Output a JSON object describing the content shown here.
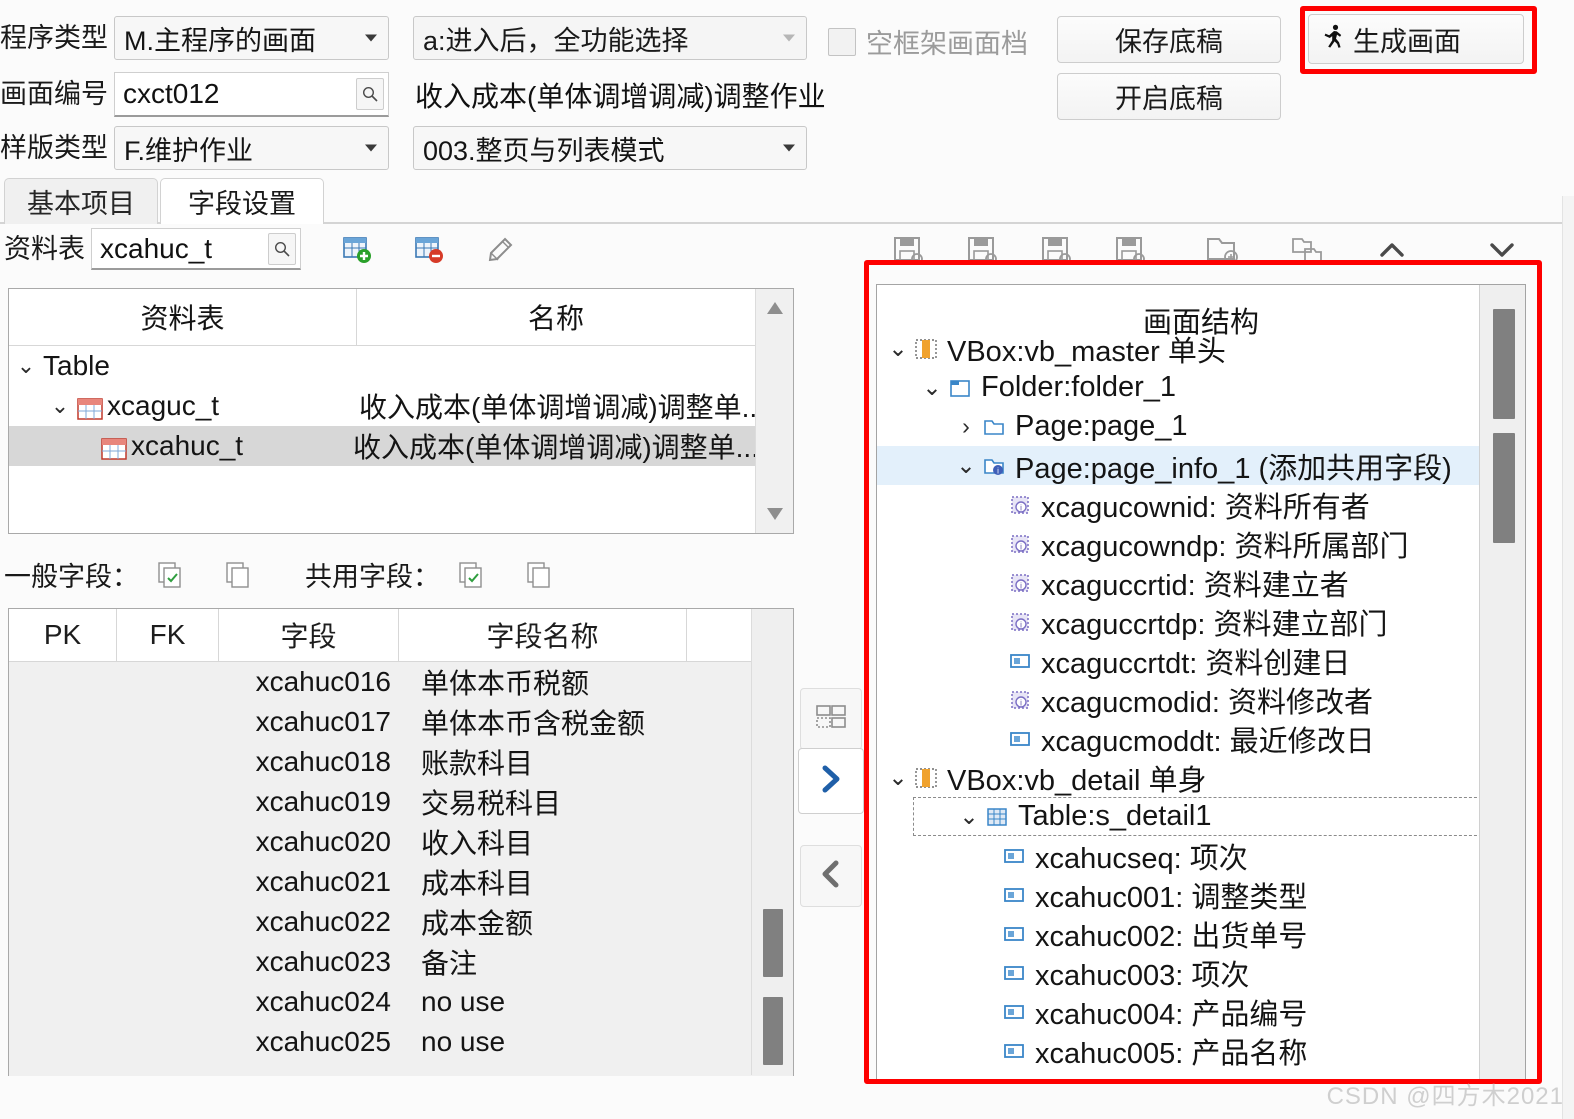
{
  "form": {
    "program_type_label": "程序类型",
    "program_type_value": "M.主程序的画面",
    "entry_mode_value": "a:进入后，全功能选择",
    "screen_no_label": "画面编号",
    "screen_no_value": "cxct012",
    "screen_title": "收入成本(单体调增调减)调整作业",
    "template_type_label": "样版类型",
    "template_type_value": "F.维护作业",
    "layout_mode_value": "003.整页与列表模式",
    "empty_frame_label": "空框架画面档",
    "save_draft_label": "保存底稿",
    "open_draft_label": "开启底稿",
    "generate_label": "生成画面"
  },
  "tabs": [
    {
      "label": "基本项目",
      "active": false
    },
    {
      "label": "字段设置",
      "active": true
    }
  ],
  "source": {
    "label": "资料表",
    "value": "xcahuc_t",
    "icons": [
      "search-icon",
      "add-table-icon",
      "remove-table-icon",
      "link-icon"
    ]
  },
  "table_tree": {
    "headers": [
      "资料表",
      "名称"
    ],
    "rows": [
      {
        "indent": 0,
        "chevron": "v",
        "icon": "none",
        "name": "Table",
        "desc": "",
        "selected": false
      },
      {
        "indent": 1,
        "chevron": "v",
        "icon": "table-icon",
        "name": "xcaguc_t",
        "desc": "收入成本(单体调增调减)调整单...",
        "selected": false
      },
      {
        "indent": 2,
        "chevron": "",
        "icon": "table-icon",
        "name": "xcahuc_t",
        "desc": "收入成本(单体调增调减)调整单...",
        "selected": true
      }
    ]
  },
  "field_captions": {
    "general_label": "一般字段：",
    "shared_label": "共用字段：",
    "icons": [
      "copy-check-icon",
      "copy-icon",
      "copy-check-icon",
      "copy-icon"
    ]
  },
  "field_grid": {
    "headers": [
      "PK",
      "FK",
      "字段",
      "字段名称",
      ""
    ],
    "rows": [
      {
        "pk": "",
        "fk": "",
        "field": "xcahuc016",
        "name": "单体本币税额"
      },
      {
        "pk": "",
        "fk": "",
        "field": "xcahuc017",
        "name": "单体本币含税金额"
      },
      {
        "pk": "",
        "fk": "",
        "field": "xcahuc018",
        "name": "账款科目"
      },
      {
        "pk": "",
        "fk": "",
        "field": "xcahuc019",
        "name": "交易税科目"
      },
      {
        "pk": "",
        "fk": "",
        "field": "xcahuc020",
        "name": "收入科目"
      },
      {
        "pk": "",
        "fk": "",
        "field": "xcahuc021",
        "name": "成本科目"
      },
      {
        "pk": "",
        "fk": "",
        "field": "xcahuc022",
        "name": "成本金额"
      },
      {
        "pk": "",
        "fk": "",
        "field": "xcahuc023",
        "name": "备注"
      },
      {
        "pk": "",
        "fk": "",
        "field": "xcahuc024",
        "name": "no use"
      },
      {
        "pk": "",
        "fk": "",
        "field": "xcahuc025",
        "name": "no use"
      }
    ]
  },
  "middle_buttons": [
    {
      "icon": "layout-icon"
    },
    {
      "icon": "chevron-right-icon"
    },
    {
      "icon": "chevron-left-icon"
    }
  ],
  "tree_toolbar": {
    "icons": [
      "save-icon",
      "save-icon",
      "save-icon",
      "save-icon",
      "folder-copy-icon",
      "move-node-icon",
      "move-up-icon",
      "move-down-icon"
    ]
  },
  "screen_tree": {
    "title": "画面结构",
    "nodes": [
      {
        "indent": 0,
        "chevron": "v",
        "icon": "vbox-icon",
        "text": "VBox:vb_master 单头",
        "selected": false,
        "dashed": false
      },
      {
        "indent": 1,
        "chevron": "v",
        "icon": "folder-ui-icon",
        "text": "Folder:folder_1",
        "selected": false,
        "dashed": false
      },
      {
        "indent": 2,
        "chevron": ">",
        "icon": "page-icon",
        "text": "Page:page_1",
        "selected": false,
        "dashed": false
      },
      {
        "indent": 2,
        "chevron": "v",
        "icon": "page-info-icon",
        "text": "Page:page_info_1 (添加共用字段)",
        "selected": true,
        "dashed": false
      },
      {
        "indent": 3,
        "chevron": "",
        "icon": "hidden-field-icon",
        "text": "xcagucownid: 资料所有者",
        "selected": false,
        "dashed": false
      },
      {
        "indent": 3,
        "chevron": "",
        "icon": "hidden-field-icon",
        "text": "xcagucowndp: 资料所属部门",
        "selected": false,
        "dashed": false
      },
      {
        "indent": 3,
        "chevron": "",
        "icon": "hidden-field-icon",
        "text": "xcaguccrtid: 资料建立者",
        "selected": false,
        "dashed": false
      },
      {
        "indent": 3,
        "chevron": "",
        "icon": "hidden-field-icon",
        "text": "xcaguccrtdp: 资料建立部门",
        "selected": false,
        "dashed": false
      },
      {
        "indent": 3,
        "chevron": "",
        "icon": "textfield-icon",
        "text": "xcaguccrtdt: 资料创建日",
        "selected": false,
        "dashed": false
      },
      {
        "indent": 3,
        "chevron": "",
        "icon": "hidden-field-icon",
        "text": "xcagucmodid: 资料修改者",
        "selected": false,
        "dashed": false
      },
      {
        "indent": 3,
        "chevron": "",
        "icon": "textfield-icon",
        "text": "xcagucmoddt: 最近修改日",
        "selected": false,
        "dashed": false
      },
      {
        "indent": 0,
        "chevron": "v",
        "icon": "vbox-icon",
        "text": "VBox:vb_detail 单身",
        "selected": false,
        "dashed": false
      },
      {
        "indent": 1,
        "chevron": "v",
        "icon": "grid-icon",
        "text": "Table:s_detail1",
        "selected": false,
        "dashed": true
      },
      {
        "indent": 2,
        "chevron": "",
        "icon": "textfield-icon",
        "text": "xcahucseq: 项次",
        "selected": false,
        "dashed": false
      },
      {
        "indent": 2,
        "chevron": "",
        "icon": "textfield-icon",
        "text": "xcahuc001: 调整类型",
        "selected": false,
        "dashed": false
      },
      {
        "indent": 2,
        "chevron": "",
        "icon": "textfield-icon",
        "text": "xcahuc002: 出货单号",
        "selected": false,
        "dashed": false
      },
      {
        "indent": 2,
        "chevron": "",
        "icon": "textfield-icon",
        "text": "xcahuc003: 项次",
        "selected": false,
        "dashed": false
      },
      {
        "indent": 2,
        "chevron": "",
        "icon": "textfield-icon",
        "text": "xcahuc004: 产品编号",
        "selected": false,
        "dashed": false
      },
      {
        "indent": 2,
        "chevron": "",
        "icon": "textfield-icon",
        "text": "xcahuc005: 产品名称",
        "selected": false,
        "dashed": false
      }
    ]
  },
  "highlight_color": "#fe0000",
  "watermark": "CSDN @四方木2021"
}
